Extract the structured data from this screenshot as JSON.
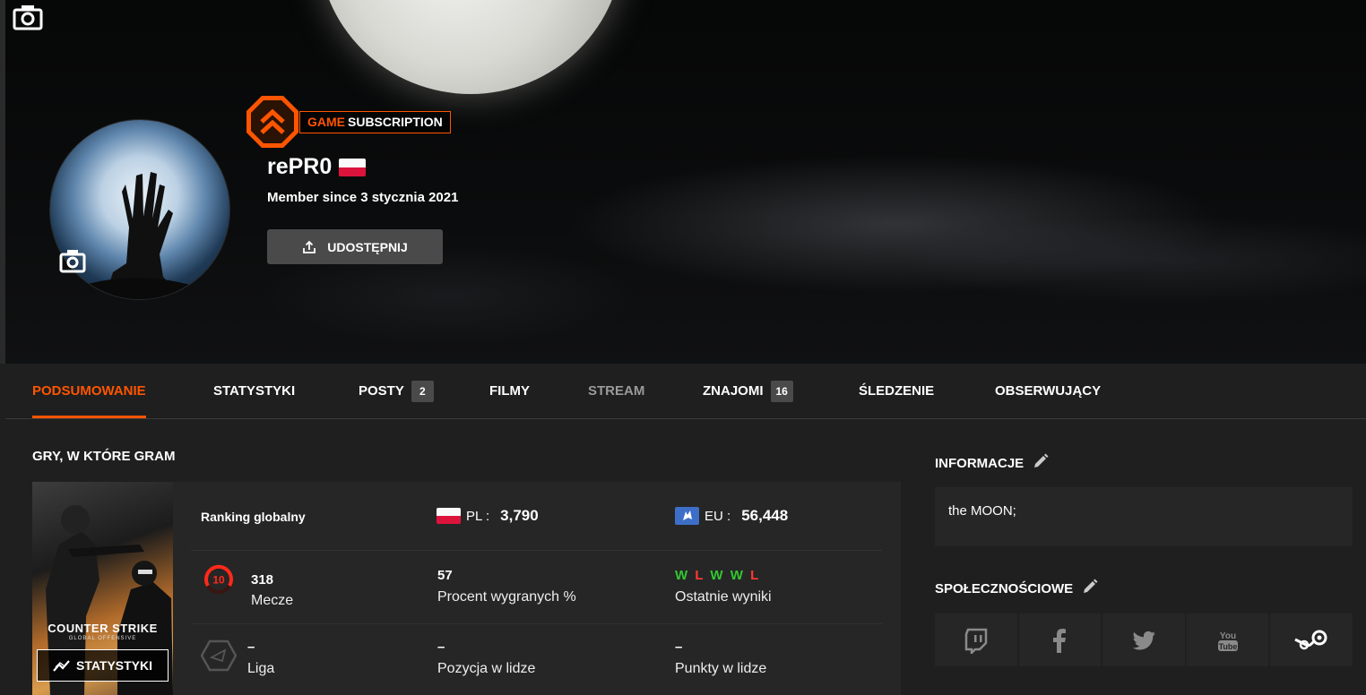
{
  "profile": {
    "nickname": "rePR0",
    "member_since": "Member since 3 stycznia 2021",
    "subscription_game": "GAME",
    "subscription_word": "SUBSCRIPTION",
    "share_label": "UDOSTĘPNIJ"
  },
  "tabs": [
    {
      "label": "PODSUMOWANIE"
    },
    {
      "label": "STATYSTYKI"
    },
    {
      "label": "POSTY",
      "count": "2"
    },
    {
      "label": "FILMY"
    },
    {
      "label": "STREAM"
    },
    {
      "label": "ZNAJOMI",
      "count": "16"
    },
    {
      "label": "ŚLEDZENIE"
    },
    {
      "label": "OBSERWUJĄCY"
    }
  ],
  "games": {
    "title": "GRY, W KTÓRE GRAM",
    "cover_logo": "COUNTER STRIKE",
    "cover_sub": "GLOBAL OFFENSIVE",
    "stats_button": "STATYSTYKI",
    "ranking_label": "Ranking globalny",
    "pl_label": "PL :",
    "pl_value": "3,790",
    "eu_label": "EU :",
    "eu_value": "56,448",
    "skill_level": "10",
    "matches_value": "318",
    "matches_label": "Mecze",
    "winrate_value": "57",
    "winrate_label": "Procent wygranych %",
    "recent_results": [
      "W",
      "L",
      "W",
      "W",
      "L"
    ],
    "recent_label": "Ostatnie wyniki",
    "league_value": "–",
    "league_label": "Liga",
    "league_pos_value": "–",
    "league_pos_label": "Pozycja w lidze",
    "league_pts_value": "–",
    "league_pts_label": "Punkty w lidze"
  },
  "info": {
    "title": "INFORMACJE",
    "text": "the MOON;"
  },
  "social": {
    "title": "SPOŁECZNOŚCIOWE",
    "icons": [
      "twitch-icon",
      "facebook-icon",
      "twitter-icon",
      "youtube-icon",
      "steam-icon"
    ]
  },
  "colors": {
    "accent": "#ff5500",
    "win": "#32c832",
    "loss": "#ff3b30"
  }
}
